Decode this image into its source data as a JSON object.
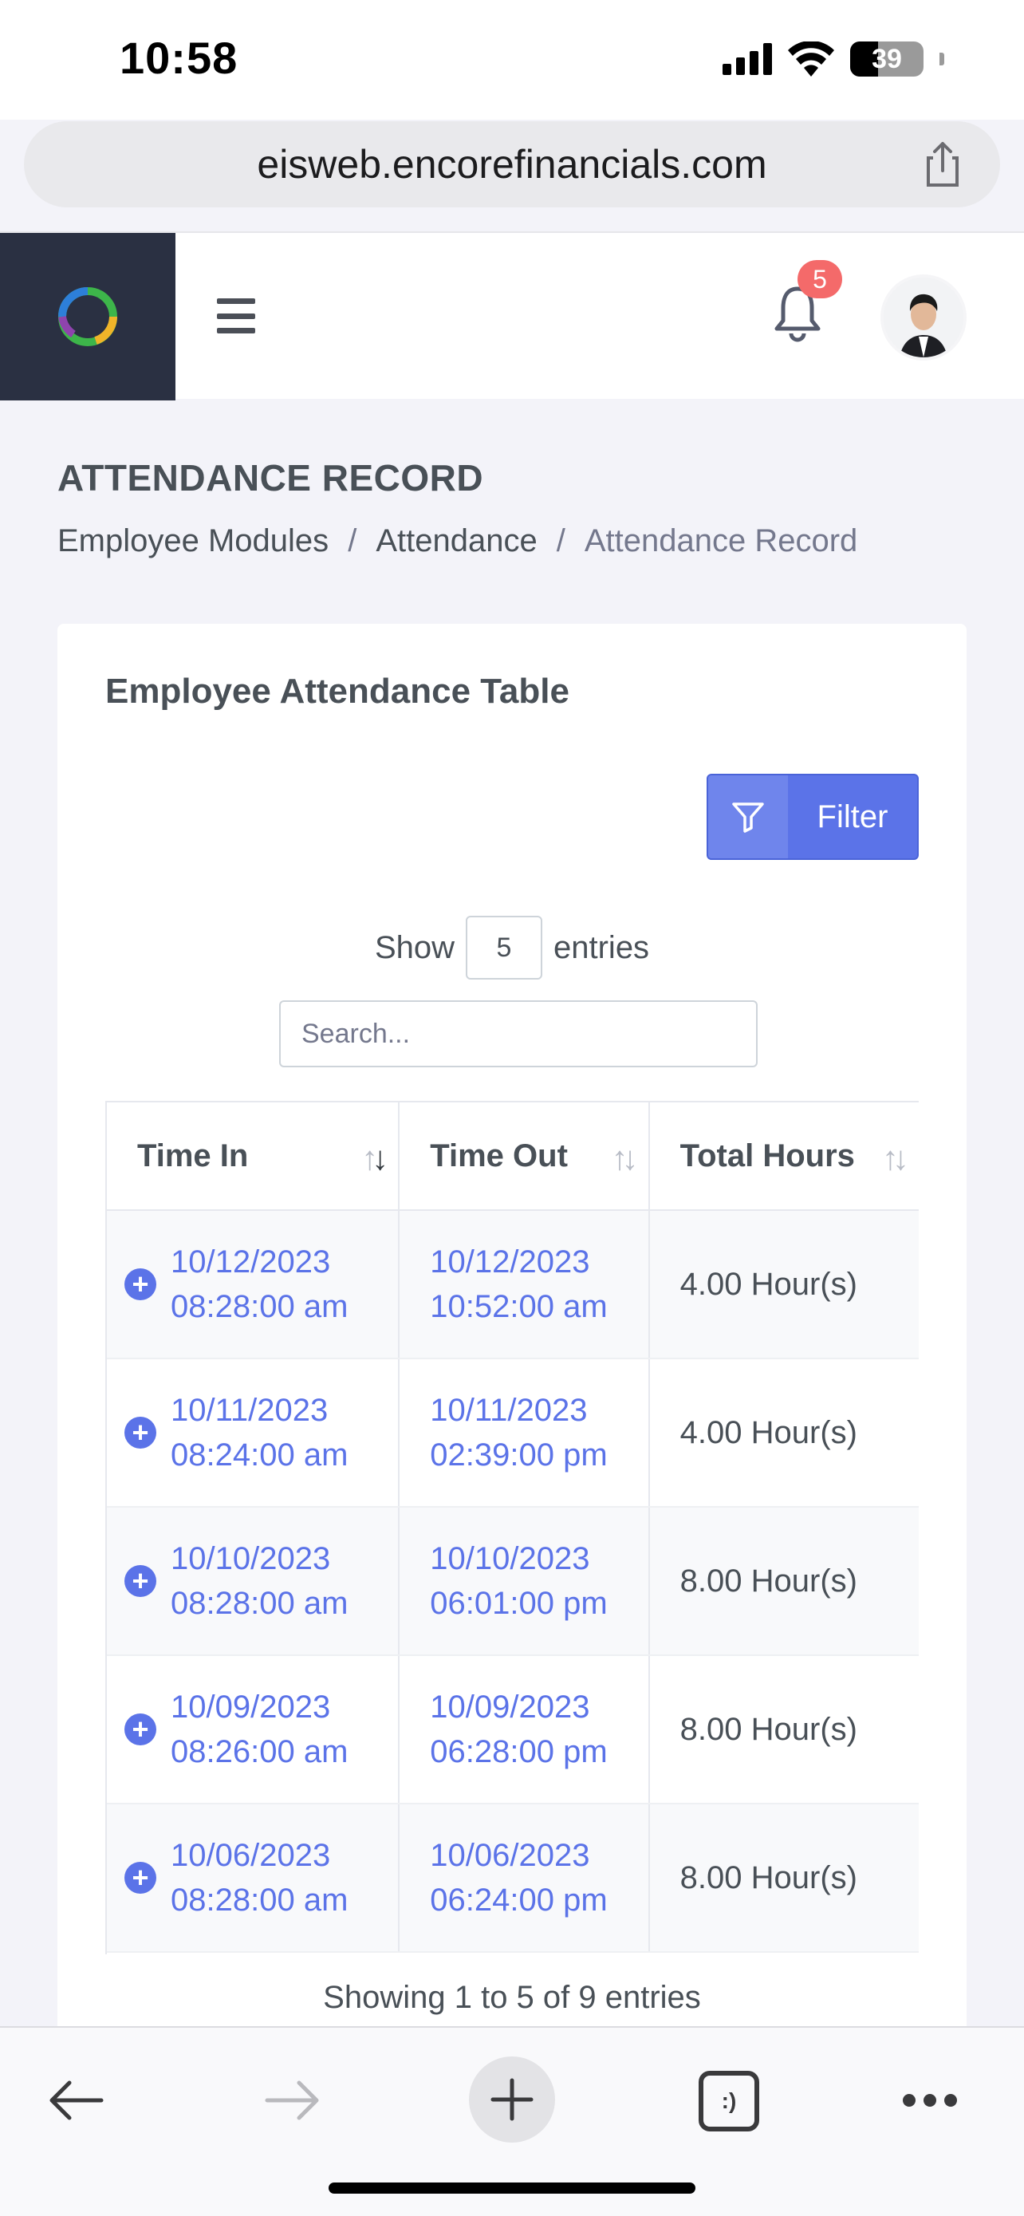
{
  "status_bar": {
    "time": "10:58",
    "battery": "39"
  },
  "browser": {
    "url": "eisweb.encorefinancials.com"
  },
  "header": {
    "notification_count": "5"
  },
  "page": {
    "title": "ATTENDANCE RECORD",
    "breadcrumb": [
      "Employee Modules",
      "Attendance",
      "Attendance Record"
    ]
  },
  "card": {
    "title": "Employee Attendance Table",
    "filter_label": "Filter",
    "show_label": "Show",
    "entries_value": "5",
    "entries_label": "entries",
    "search_placeholder": "Search...",
    "columns": [
      "Time In",
      "Time Out",
      "Total Hours"
    ],
    "rows": [
      {
        "in_date": "10/12/2023",
        "in_time": "08:28:00 am",
        "out_date": "10/12/2023",
        "out_time": "10:52:00 am",
        "hours": "4.00 Hour(s)"
      },
      {
        "in_date": "10/11/2023",
        "in_time": "08:24:00 am",
        "out_date": "10/11/2023",
        "out_time": "02:39:00 pm",
        "hours": "4.00 Hour(s)"
      },
      {
        "in_date": "10/10/2023",
        "in_time": "08:28:00 am",
        "out_date": "10/10/2023",
        "out_time": "06:01:00 pm",
        "hours": "8.00 Hour(s)"
      },
      {
        "in_date": "10/09/2023",
        "in_time": "08:26:00 am",
        "out_date": "10/09/2023",
        "out_time": "06:28:00 pm",
        "hours": "8.00 Hour(s)"
      },
      {
        "in_date": "10/06/2023",
        "in_time": "08:28:00 am",
        "out_date": "10/06/2023",
        "out_time": "06:24:00 pm",
        "hours": "8.00 Hour(s)"
      }
    ],
    "table_info": "Showing 1 to 5 of 9 entries"
  },
  "toolbar": {
    "tabs_label": ":)"
  },
  "colors": {
    "accent": "#5b73e8",
    "sidebar": "#2a3042",
    "badge": "#f46a6a"
  },
  "icons": [
    "signal-icon",
    "wifi-icon",
    "battery-icon",
    "share-icon",
    "logo-icon",
    "hamburger-icon",
    "bell-icon",
    "filter-icon",
    "sort-icon",
    "expand-icon",
    "back-icon",
    "forward-icon",
    "new-tab-icon",
    "tabs-icon",
    "more-icon"
  ]
}
